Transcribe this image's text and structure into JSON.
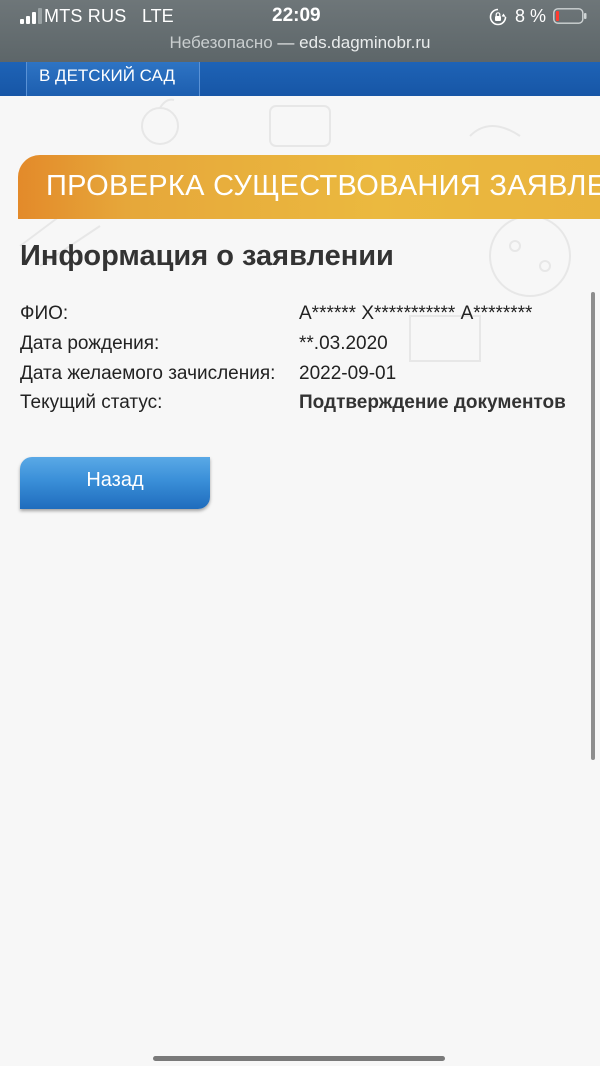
{
  "status_bar": {
    "carrier": "MTS RUS",
    "network": "LTE",
    "time": "22:09",
    "battery": "8 %"
  },
  "url_bar": {
    "insecure_label": "Небезопасно",
    "separator": " — ",
    "domain": "eds.dagminobr.ru"
  },
  "nav": {
    "kindergarten_label": "В ДЕТСКИЙ САД"
  },
  "banner": {
    "title": "ПРОВЕРКА СУЩЕСТВОВАНИЯ ЗАЯВЛЕНИЯ"
  },
  "section": {
    "title": "Информация о заявлении"
  },
  "info": {
    "rows": [
      {
        "label": "ФИО:",
        "value": "А****** Х*********** А********"
      },
      {
        "label": "Дата рождения:",
        "value": "**.03.2020"
      },
      {
        "label": "Дата желаемого зачисления:",
        "value": "2022-09-01"
      },
      {
        "label": "Текущий статус:",
        "value": "Подтверждение документов"
      }
    ]
  },
  "actions": {
    "back_label": "Назад"
  },
  "colors": {
    "nav_blue": "#1d5eaf",
    "banner_orange": "#e38a2a",
    "banner_yellow": "#ebb93f",
    "button_blue": "#3a8fd8"
  }
}
